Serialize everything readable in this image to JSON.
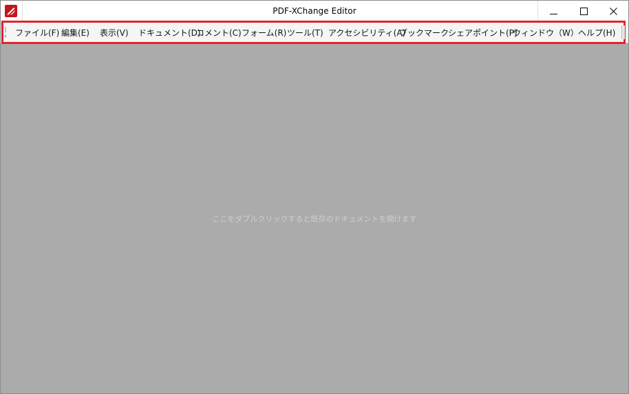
{
  "window": {
    "title": "PDF-XChange Editor",
    "accent_color": "#e3222a",
    "app_icon_color": "#c4161c",
    "controls": {
      "minimize": "minimize-icon",
      "maximize": "maximize-icon",
      "close": "close-icon"
    }
  },
  "menubar": {
    "items": [
      {
        "label": "ファイル(F)"
      },
      {
        "label": "編集(E)"
      },
      {
        "label": "表示(V)"
      },
      {
        "label": "ドキュメント(D)"
      },
      {
        "label": "コメント(C)"
      },
      {
        "label": "フォーム(R)"
      },
      {
        "label": "ツール(T)"
      },
      {
        "label": "アクセシビリティ(A)"
      },
      {
        "label": "ブックマーク"
      },
      {
        "label": "シェアポイント(P)"
      },
      {
        "label": "ウィンドウ（W）"
      },
      {
        "label": "ヘルプ(H)"
      }
    ]
  },
  "content": {
    "empty_hint": "ここをダブルクリックすると既存のドキュメントを開けます"
  }
}
